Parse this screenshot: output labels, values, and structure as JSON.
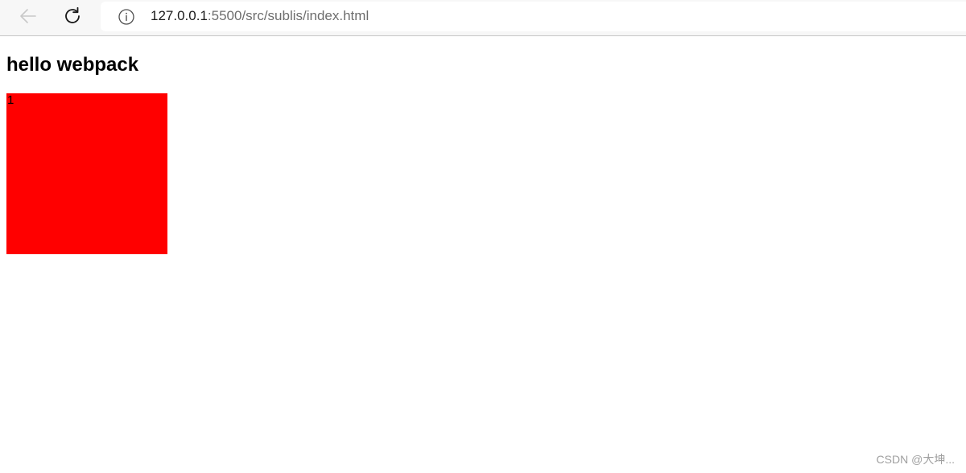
{
  "browser": {
    "url_host": "127.0.0.1",
    "url_rest": ":5500/src/sublis/index.html",
    "icons": {
      "back": "back-arrow-icon",
      "reload": "reload-icon",
      "info": "info-icon"
    }
  },
  "page": {
    "title": "hello webpack",
    "box_text": "1",
    "box_color": "#ff0000"
  },
  "watermark": {
    "text": "CSDN @大坤..."
  }
}
